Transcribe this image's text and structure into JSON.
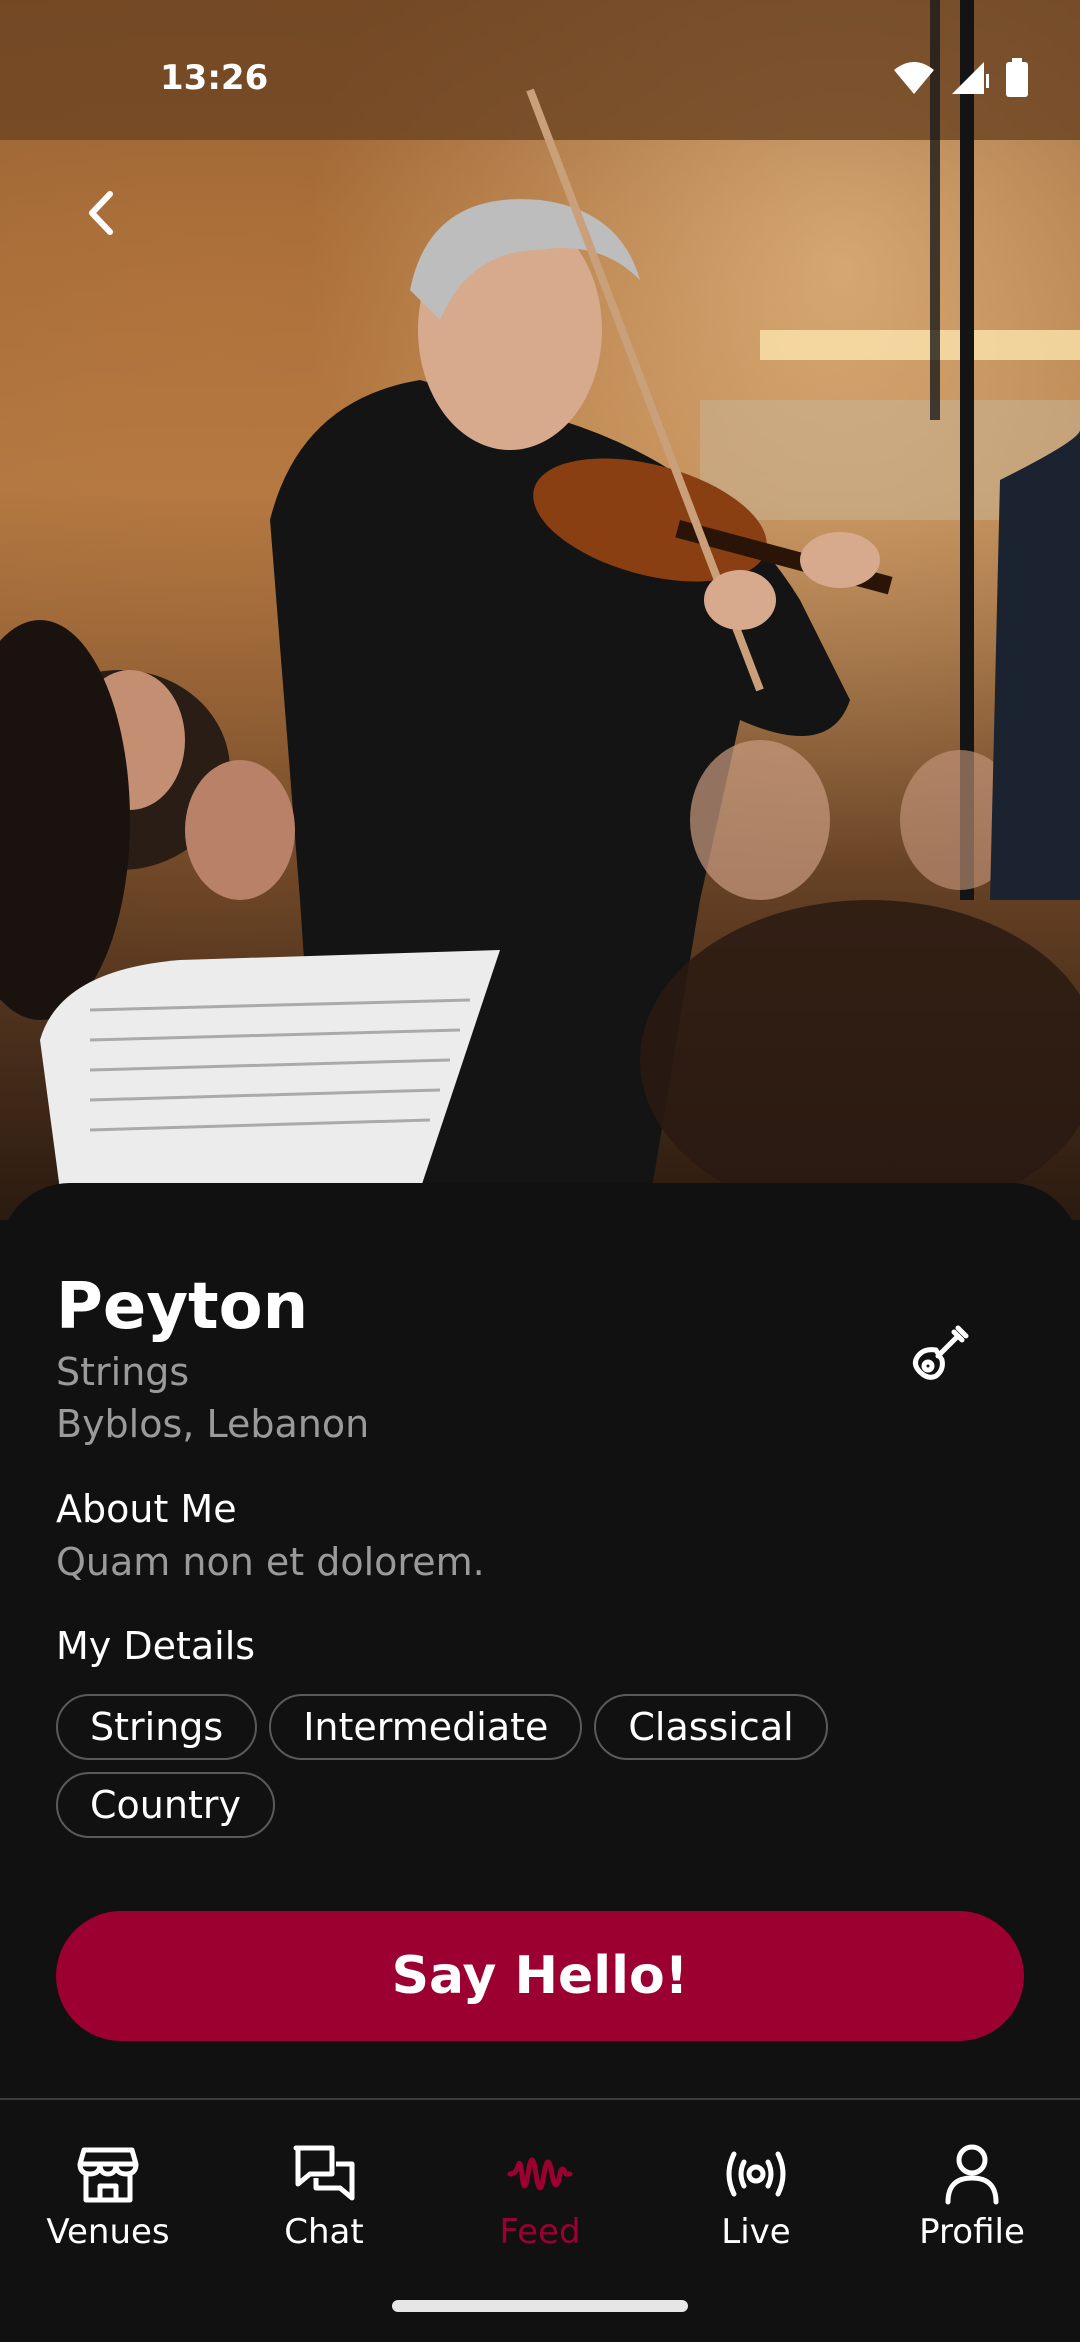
{
  "status_bar": {
    "time": "13:26"
  },
  "profile": {
    "name": "Peyton",
    "instrument": "Strings",
    "location": "Byblos, Lebanon"
  },
  "about": {
    "title": "About Me",
    "text": "Quam non et dolorem."
  },
  "details": {
    "title": "My Details",
    "chips": [
      "Strings",
      "Intermediate",
      "Classical",
      "Country"
    ]
  },
  "cta": {
    "label": "Say Hello!"
  },
  "nav": {
    "items": [
      {
        "label": "Venues",
        "icon": "store-icon",
        "active": false
      },
      {
        "label": "Chat",
        "icon": "chat-icon",
        "active": false
      },
      {
        "label": "Feed",
        "icon": "waveform-icon",
        "active": true
      },
      {
        "label": "Live",
        "icon": "broadcast-icon",
        "active": false
      },
      {
        "label": "Profile",
        "icon": "person-icon",
        "active": false
      }
    ]
  },
  "colors": {
    "accent": "#9b0030",
    "background": "#111111",
    "muted_text": "#9a9a9a"
  }
}
